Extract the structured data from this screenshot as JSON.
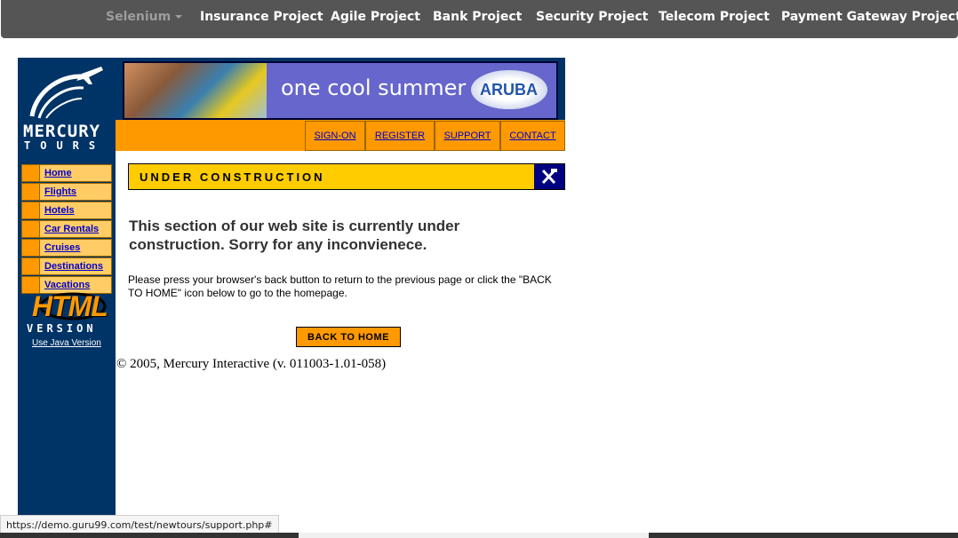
{
  "topnav": {
    "items": [
      {
        "label": "Selenium",
        "dropdown": true
      },
      {
        "label": "Insurance Project"
      },
      {
        "label": "Agile Project"
      },
      {
        "label": "Bank Project"
      },
      {
        "label": "Security Project"
      },
      {
        "label": "Telecom Project"
      },
      {
        "label": "Payment Gateway Project"
      }
    ]
  },
  "logo": {
    "line1": "MERCURY",
    "line2": "TOURS",
    "icon": "airplane-arc-icon"
  },
  "sidebar": {
    "items": [
      {
        "label": "Home"
      },
      {
        "label": "Flights"
      },
      {
        "label": "Hotels"
      },
      {
        "label": "Car Rentals"
      },
      {
        "label": "Cruises"
      },
      {
        "label": "Destinations"
      },
      {
        "label": "Vacations"
      }
    ],
    "html_badge": "HTML",
    "version": "VERSION",
    "java_link": "Use Java Version"
  },
  "banner": {
    "text": "one cool summer",
    "brand": "ARUBA"
  },
  "menu": {
    "signon": "SIGN-ON",
    "register": "REGISTER",
    "support": "SUPPORT",
    "contact": "CONTACT"
  },
  "main": {
    "banner_title": "UNDER CONSTRUCTION",
    "tools_icon": "tools-icon",
    "heading": "This section of our web site is currently under construction.   Sorry for any inconvienece.",
    "paragraph": "Please press your browser's back button to return to the previous page or click the \"BACK TO HOME\" icon below to go to the homepage.",
    "back_button": "BACK TO HOME",
    "copyright": "© 2005, Mercury Interactive (v. 011003-1.01-058)"
  },
  "status_bar": {
    "url": "https://demo.guru99.com/test/newtours/support.php#"
  },
  "colors": {
    "nav_bg": "#555555",
    "sidebar_bg": "#003366",
    "orange": "#ff9900",
    "yellow": "#ffcc00",
    "link": "#0000cc"
  }
}
